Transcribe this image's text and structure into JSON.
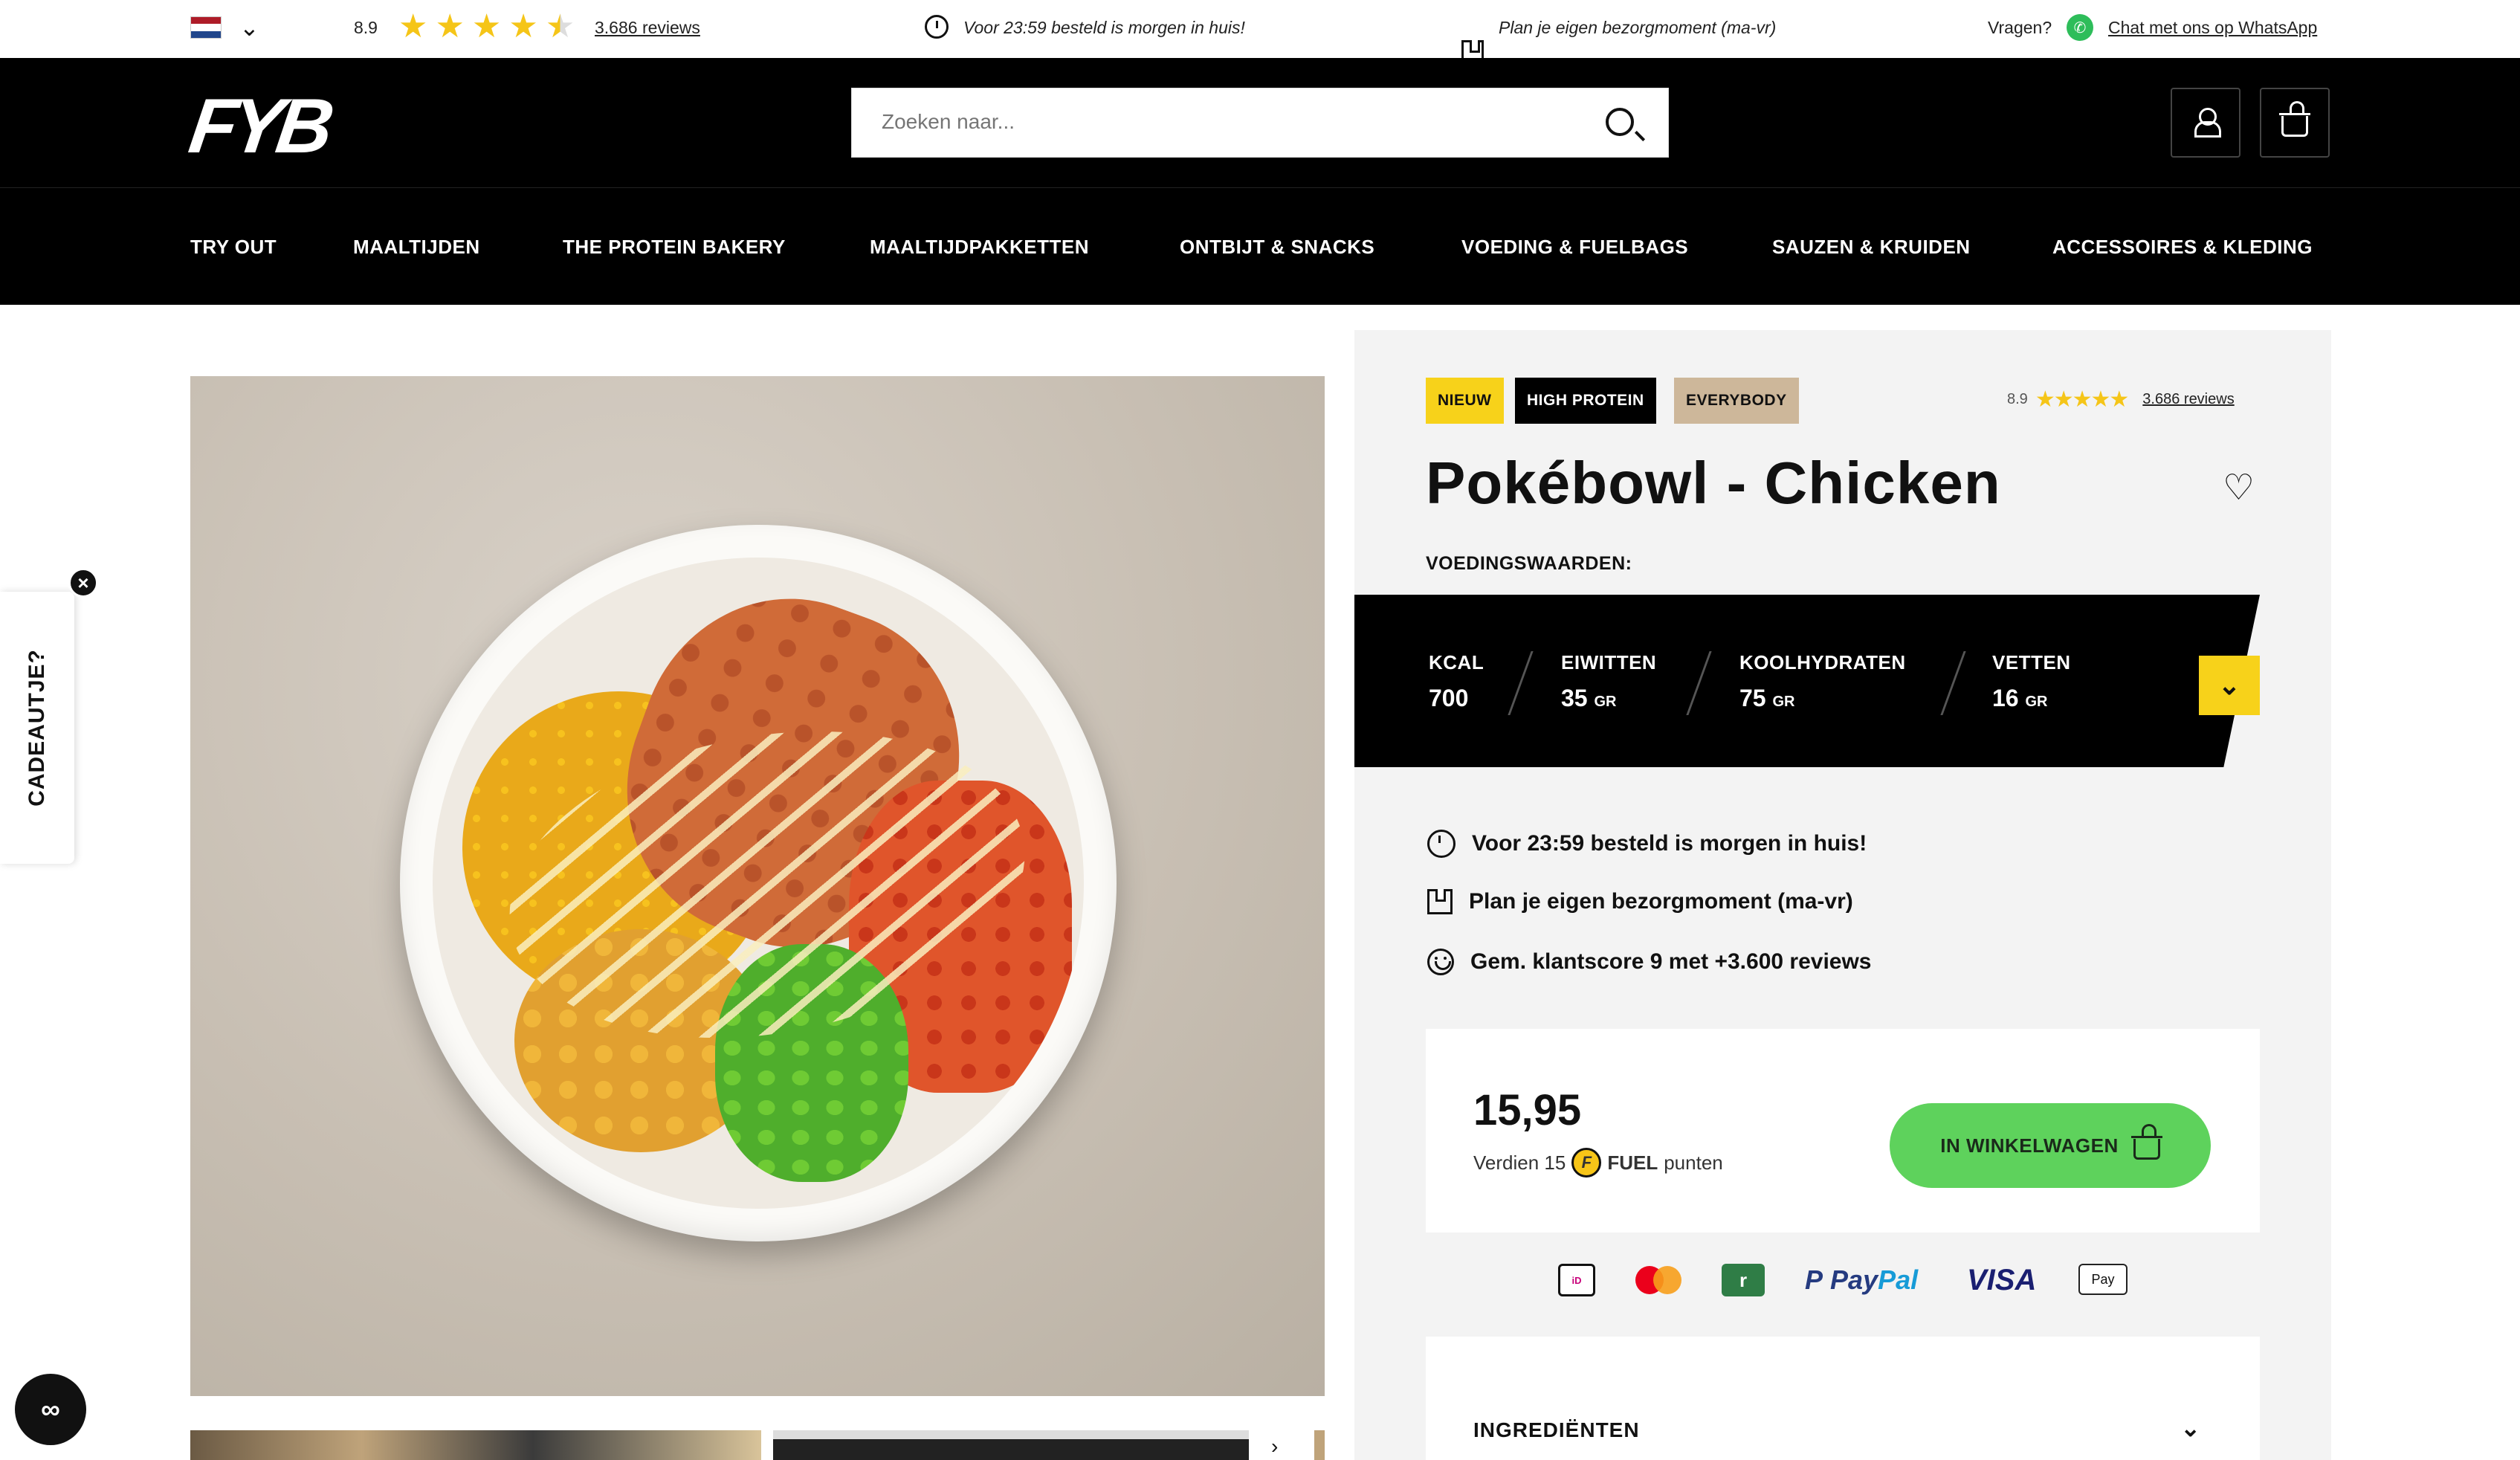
{
  "topbar": {
    "rating": "8.9",
    "reviews_link": "3.686 reviews",
    "usp_delivery": "Voor 23:59 besteld is morgen in huis!",
    "usp_plan": "Plan je eigen bezorgmoment (ma-vr)",
    "questions": "Vragen?",
    "whatsapp_link": "Chat met ons op WhatsApp"
  },
  "header": {
    "logo": "FYB",
    "search_placeholder": "Zoeken naar..."
  },
  "nav": {
    "items": [
      "TRY OUT",
      "MAALTIJDEN",
      "THE PROTEIN BAKERY",
      "MAALTIJDPAKKETTEN",
      "ONTBIJT & SNACKS",
      "VOEDING & FUELBAGS",
      "SAUZEN & KRUIDEN",
      "ACCESSOIRES & KLEDING"
    ]
  },
  "gift_tab": {
    "label": "CADEAUTJE?"
  },
  "product": {
    "badges": [
      "NIEUW",
      "HIGH PROTEIN",
      "EVERYBODY"
    ],
    "badge_colors": [
      "#f7d21a",
      "#000000",
      "#cdb79a"
    ],
    "rating": "8.9",
    "reviews_link": "3.686 reviews",
    "title": "Pokébowl - Chicken",
    "nutrition_label": "VOEDINGSWAARDEN:",
    "nutrition": [
      {
        "label": "KCAL",
        "value": "700",
        "unit": ""
      },
      {
        "label": "EIWITTEN",
        "value": "35",
        "unit": "GR"
      },
      {
        "label": "KOOLHYDRATEN",
        "value": "75",
        "unit": "GR"
      },
      {
        "label": "VETTEN",
        "value": "16",
        "unit": "GR"
      }
    ],
    "usps": [
      "Voor 23:59 besteld is morgen in huis!",
      "Plan je eigen bezorgmoment (ma-vr)",
      "Gem. klantscore 9 met +3.600 reviews"
    ],
    "price": "15,95",
    "earn_prefix": "Verdien 15",
    "earn_fuel": "FUEL",
    "earn_suffix": "punten",
    "cart_button": "IN WINKELWAGEN",
    "payment_methods": [
      "iDEAL",
      "MasterCard",
      "Klarna",
      "PayPal",
      "VISA",
      "Apple Pay"
    ],
    "ingredients_label": "INGREDIËNTEN"
  },
  "colors": {
    "accent_yellow": "#f7d21a",
    "cart_green": "#5ed25c",
    "star": "#f5c518"
  },
  "icons": [
    "flag-nl-icon",
    "chevron-down-icon",
    "star-icon",
    "clock-icon",
    "calendar-icon",
    "whatsapp-icon",
    "search-icon",
    "user-icon",
    "basket-icon",
    "heart-icon",
    "smile-icon",
    "close-icon",
    "accessibility-icon"
  ]
}
